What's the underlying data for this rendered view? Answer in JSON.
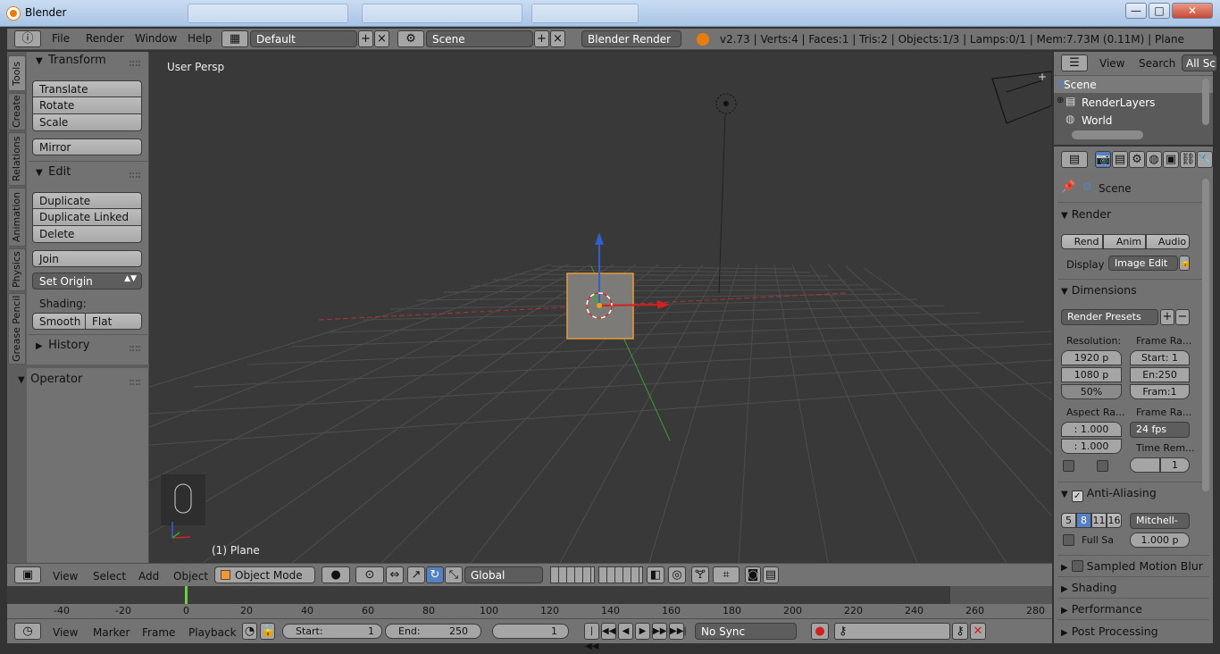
{
  "window": {
    "title": "Blender",
    "background_tabs": [
      "",
      "",
      "",
      ""
    ],
    "btn_minimize": "—",
    "btn_maximize": "□",
    "btn_close": "✕"
  },
  "main_header": {
    "menus": [
      "File",
      "Render",
      "Window",
      "Help"
    ],
    "layout": "Default",
    "scene": "Scene",
    "engine": "Blender Render",
    "stats": "v2.73 | Verts:4 | Faces:1 | Tris:2 | Objects:1/3 | Lamps:0/1 | Mem:7.73M (0.11M) | Plane"
  },
  "toolshelf": {
    "tabs": [
      "Tools",
      "Create",
      "Relations",
      "Animation",
      "Physics",
      "Grease Pencil"
    ],
    "transform": {
      "title": "Transform",
      "buttons": [
        "Translate",
        "Rotate",
        "Scale"
      ],
      "mirror": "Mirror"
    },
    "edit": {
      "title": "Edit",
      "buttons": [
        "Duplicate",
        "Duplicate Linked",
        "Delete"
      ],
      "join": "Join",
      "set_origin": "Set Origin",
      "shading_label": "Shading:",
      "smooth": "Smooth",
      "flat": "Flat"
    },
    "history": "History",
    "operator": "Operator"
  },
  "viewport": {
    "view_label": "User Persp",
    "object_label": "(1) Plane"
  },
  "view_header": {
    "menus": [
      "View",
      "Select",
      "Add",
      "Object"
    ],
    "mode": "Object Mode",
    "orientation": "Global"
  },
  "timeline": {
    "ticks": [
      "-40",
      "-20",
      "0",
      "20",
      "40",
      "60",
      "80",
      "100",
      "120",
      "140",
      "160",
      "180",
      "200",
      "220",
      "240",
      "260",
      "280"
    ],
    "current_frame_marker": 0,
    "menus": [
      "View",
      "Marker",
      "Frame",
      "Playback"
    ],
    "start_label": "Start:",
    "start": "1",
    "end_label": "End:",
    "end": "250",
    "current": "1",
    "sync": "No Sync"
  },
  "outliner": {
    "menus": [
      "View",
      "Search",
      "All Sc"
    ],
    "items": [
      "Scene",
      "RenderLayers",
      "World"
    ]
  },
  "properties": {
    "context": "Scene",
    "render": {
      "title": "Render",
      "rend": "Rend",
      "anim": "Anim",
      "audio": "Audio",
      "display_label": "Display",
      "display": "Image Edit"
    },
    "dimensions": {
      "title": "Dimensions",
      "presets": "Render Presets",
      "resolution_label": "Resolution:",
      "res_x": "1920 p",
      "res_y": "1080 p",
      "res_pct": "50%",
      "frame_range_label": "Frame Ra...",
      "start": "Start: 1",
      "end": "En:250",
      "step": "Fram:1",
      "aspect_label": "Aspect Ra...",
      "aspect_x": ": 1.000",
      "aspect_y": ": 1.000",
      "frame_rate_label": "Frame Ra...",
      "fps": "24 fps",
      "time_remap_label": "Time Rem...",
      "time_remap_new": "1"
    },
    "aa": {
      "title": "Anti-Aliasing",
      "samples": [
        "5",
        "8",
        "11",
        "16"
      ],
      "filter": "Mitchell-",
      "full_sample": "Full Sa",
      "filter_size": "1.000 p"
    },
    "collapsed_sections": [
      "Sampled Motion Blur",
      "Shading",
      "Performance",
      "Post Processing"
    ]
  }
}
